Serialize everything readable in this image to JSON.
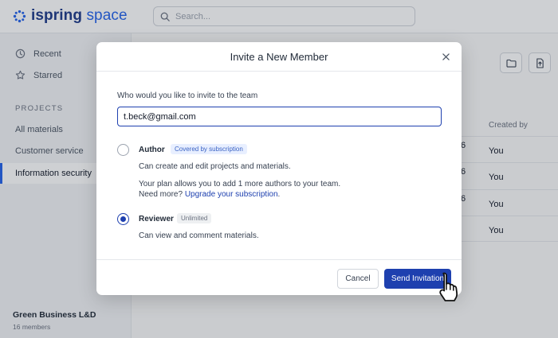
{
  "app": {
    "logo_word1": "ispring",
    "logo_word2": "space",
    "search_placeholder": "Search..."
  },
  "sidebar": {
    "recent": "Recent",
    "starred": "Starred",
    "section": "PROJECTS",
    "items": [
      "All materials",
      "Customer service",
      "Information security"
    ],
    "active_item": "Information security",
    "org_name": "Green Business L&D",
    "org_members": "16 members"
  },
  "table": {
    "created_by_header": "Created by",
    "rows": [
      {
        "num": "6",
        "who": "You"
      },
      {
        "num": "6",
        "who": "You"
      },
      {
        "num": "6",
        "who": "You"
      },
      {
        "num": "",
        "who": "You"
      }
    ]
  },
  "modal": {
    "title": "Invite a New Member",
    "question": "Who would you like to invite to the team",
    "email_value": "t.beck@gmail.com",
    "author": {
      "name": "Author",
      "badge": "Covered by subscription",
      "desc": "Can create and edit projects and materials.",
      "note_line1": "Your plan allows you to add 1 more authors to your team.",
      "note_line2_prefix": "Need more?",
      "note_link": "Upgrade your subscription",
      "note_suffix": "."
    },
    "reviewer": {
      "name": "Reviewer",
      "badge": "Unlimited",
      "desc": "Can view and comment materials."
    },
    "cancel_label": "Cancel",
    "send_label": "Send Invitation"
  },
  "colors": {
    "brand_dark": "#1e3a8a",
    "brand_accent": "#2563eb",
    "primary_button": "#1e40af"
  },
  "icons": {
    "recent": "clock-icon",
    "starred": "star-icon",
    "folder": "folder-icon",
    "upload": "upload-icon",
    "close": "close-icon",
    "cursor": "hand-pointer-icon"
  }
}
